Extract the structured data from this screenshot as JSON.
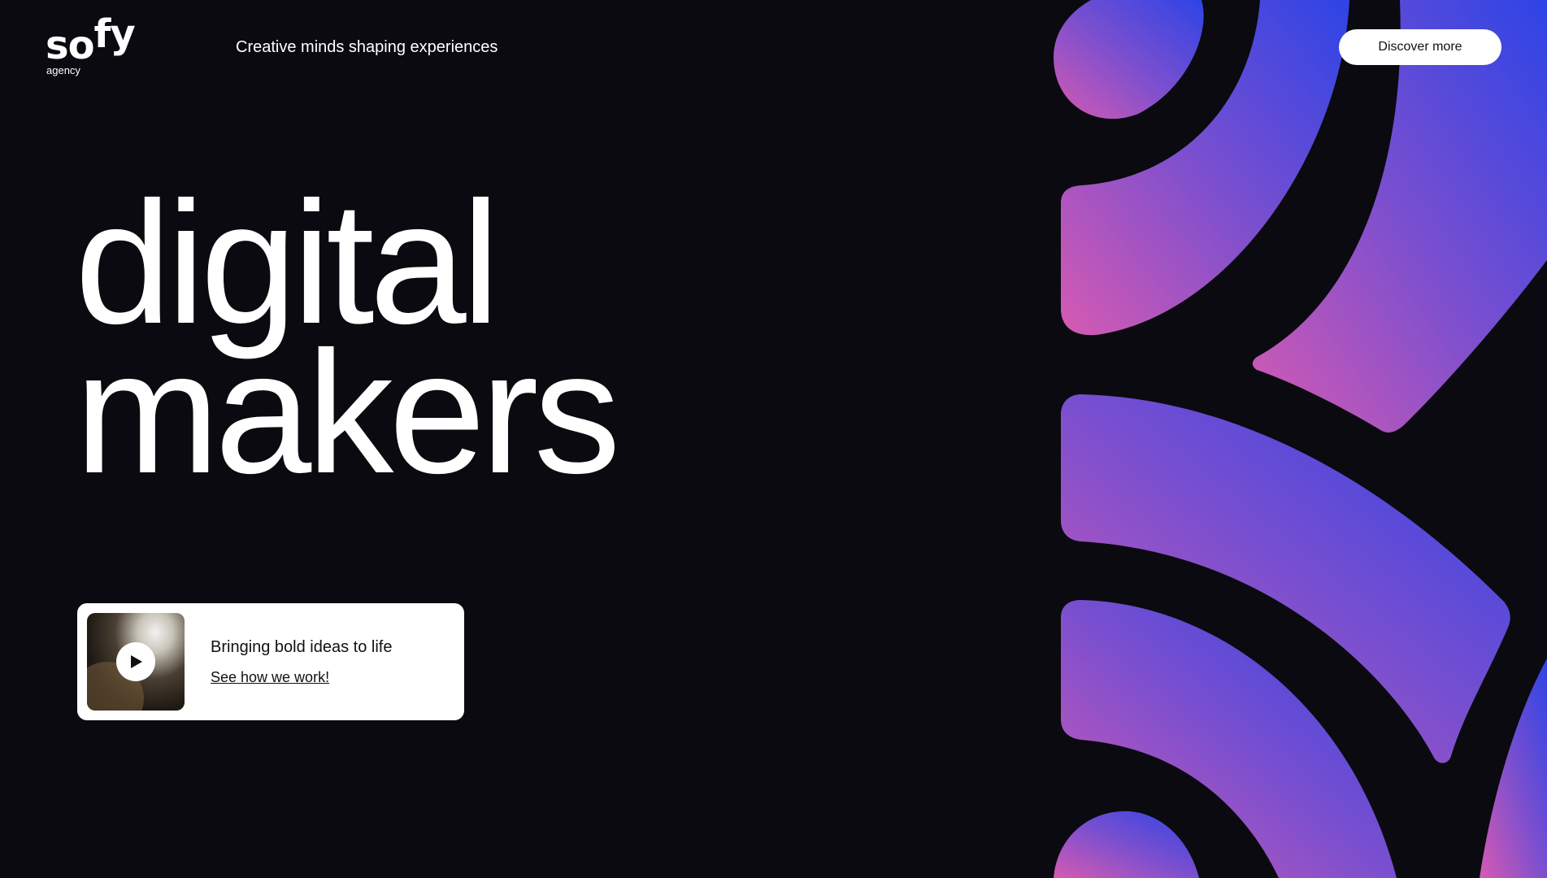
{
  "brand": {
    "logo_text_main": "so",
    "logo_text_raise": "fy",
    "logo_subtext": "agency"
  },
  "header": {
    "tagline": "Creative minds shaping experiences",
    "cta_label": "Discover more"
  },
  "hero": {
    "line1": "digital",
    "line2": "makers"
  },
  "video_card": {
    "title": "Bringing bold ideas to life",
    "link_label": "See how we work!",
    "thumb_icon": "play-icon"
  },
  "colors": {
    "background": "#0a0a10",
    "art_gradient_top": "#3a47e0",
    "art_gradient_mid": "#7b4fd0",
    "art_gradient_bottom": "#d35bb5",
    "button_bg": "#ffffff"
  }
}
